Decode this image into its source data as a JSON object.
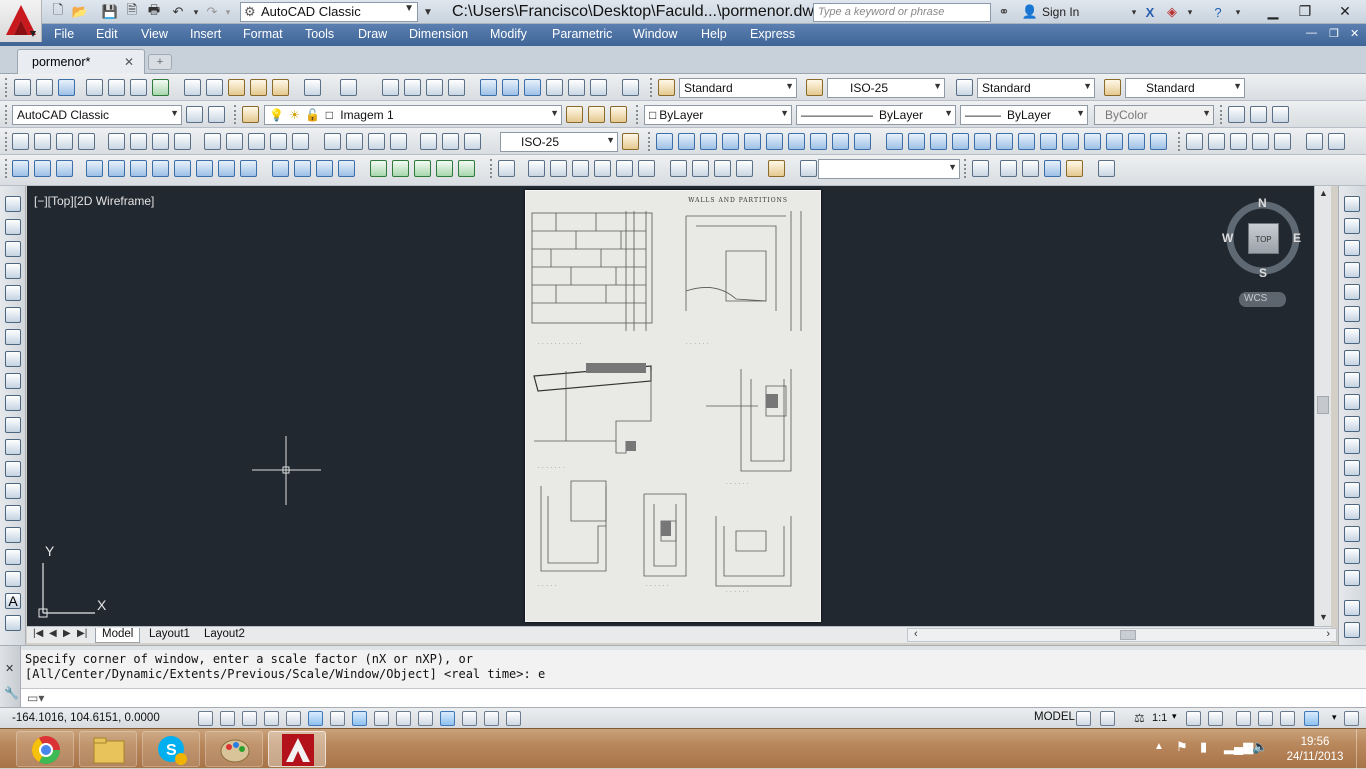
{
  "titlebar": {
    "workspace": "AutoCAD Classic",
    "window_title": "C:\\Users\\Francisco\\Desktop\\Faculd...\\pormenor.dwg",
    "search_placeholder": "Type a keyword or phrase",
    "sign_in": "Sign In"
  },
  "menu": [
    "File",
    "Edit",
    "View",
    "Insert",
    "Format",
    "Tools",
    "Draw",
    "Dimension",
    "Modify",
    "Parametric",
    "Window",
    "Help",
    "Express"
  ],
  "doc_tab": {
    "label": "pormenor*"
  },
  "toolbar2": {
    "text_style": "Standard",
    "dim_style": "ISO-25",
    "table_style": "Standard",
    "mleader_style": "Standard"
  },
  "toolbar3": {
    "workspace": "AutoCAD Classic",
    "layer": "Imagem 1",
    "color": "ByLayer",
    "linetype": "ByLayer",
    "lineweight": "ByLayer",
    "plotstyle": "ByColor"
  },
  "toolbar4": {
    "dim_style": "ISO-25"
  },
  "viewport": {
    "label": "[−][Top][2D Wireframe]",
    "sheet_header": "WALLS AND PARTITIONS",
    "viewcube": {
      "n": "N",
      "s": "S",
      "e": "E",
      "w": "W",
      "top": "TOP",
      "wcs": "WCS"
    },
    "ucs": {
      "x": "X",
      "y": "Y"
    }
  },
  "layouts": [
    "Model",
    "Layout1",
    "Layout2"
  ],
  "command": {
    "line1": "Specify corner of window, enter a scale factor (nX or nXP), or",
    "line2": "[All/Center/Dynamic/Extents/Previous/Scale/Window/Object] <real time>: e"
  },
  "status": {
    "coords": "-164.1016, 104.6151, 0.0000",
    "model": "MODEL",
    "scale": "1:1"
  },
  "taskbar": {
    "time": "19:56",
    "date": "24/11/2013"
  }
}
